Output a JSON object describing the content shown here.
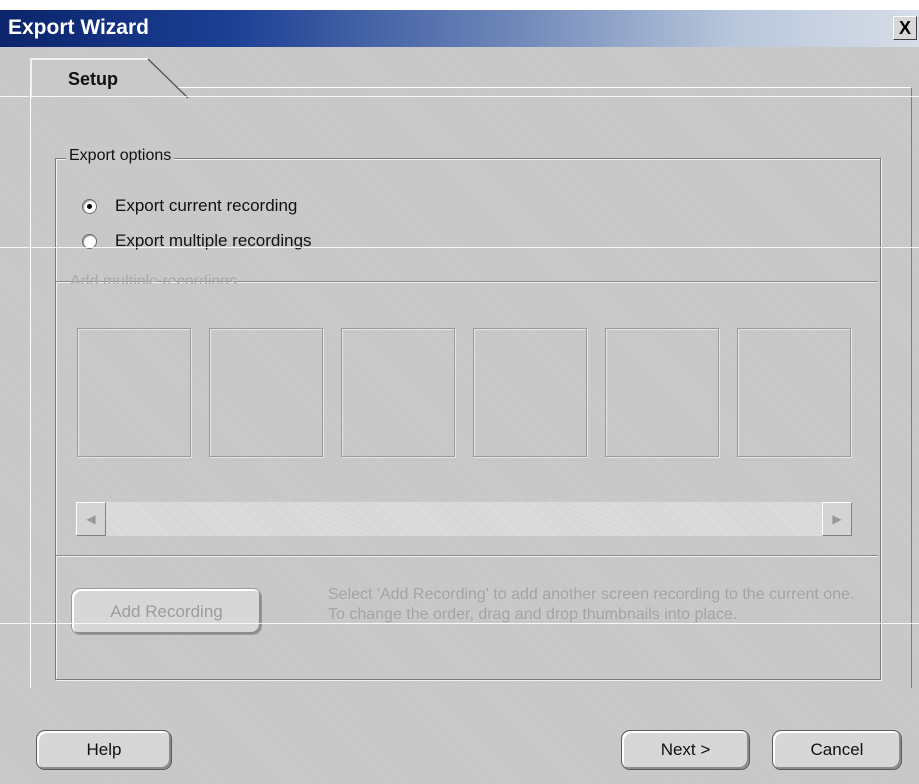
{
  "window": {
    "title": "Export Wizard",
    "close_label": "X"
  },
  "tab": {
    "label": "Setup"
  },
  "export_options": {
    "title": "Export options",
    "options": [
      {
        "label": "Export current recording",
        "checked": true
      },
      {
        "label": "Export multiple recordings",
        "checked": false
      }
    ]
  },
  "multiple": {
    "title": "Add multiple recordings",
    "thumbnail_count": 6,
    "scroll_left_icon": "scroll-left-arrow",
    "scroll_right_icon": "scroll-right-arrow"
  },
  "add_recording": {
    "button_label": "Add Recording",
    "hint": "Select 'Add Recording' to add another screen recording to the current one. To change the order, drag and drop thumbnails into place."
  },
  "footer": {
    "help_label": "Help",
    "next_label": "Next >",
    "cancel_label": "Cancel"
  },
  "colors": {
    "titlebar_start": "#0b246b",
    "titlebar_end": "#d7dde8",
    "dialog_bg": "#c9c9c9",
    "disabled_text": "#a4a4a4"
  }
}
